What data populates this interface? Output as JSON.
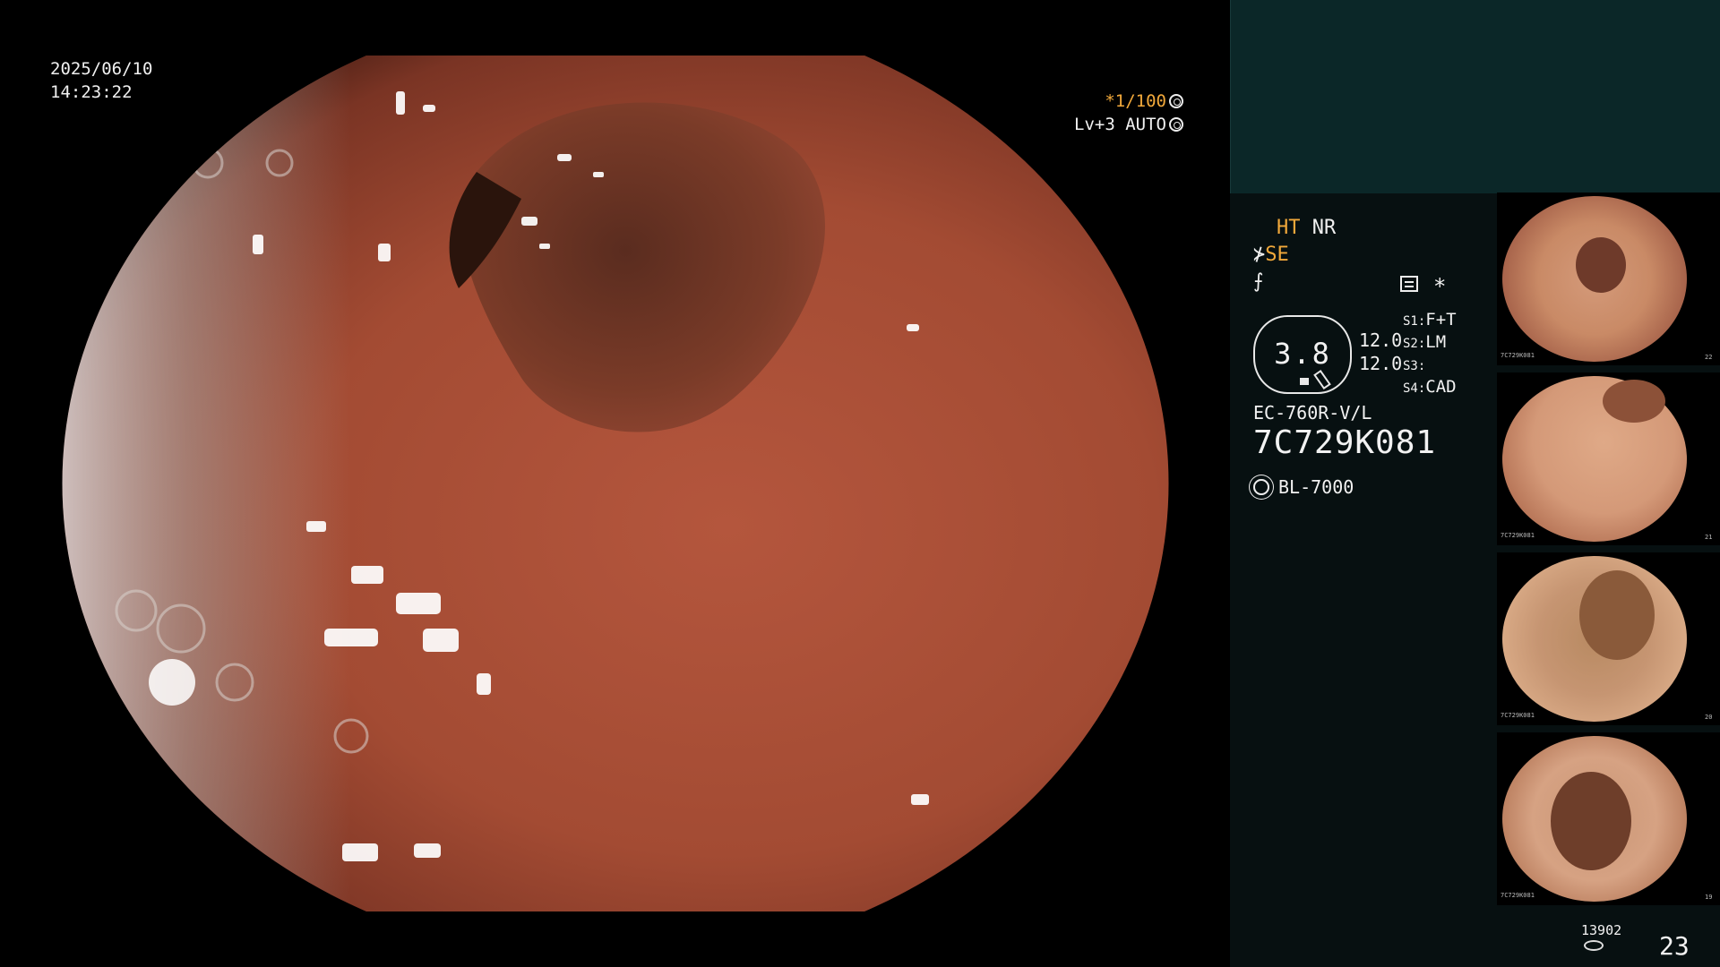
{
  "overlay": {
    "date": "2025/06/10",
    "time": "14:23:22",
    "shutter_prefix": "*1/100",
    "level": "Lv+3 AUTO"
  },
  "panel": {
    "ht": "HT",
    "nr": "NR",
    "se": "SE",
    "mode_symbol_1": "⊁",
    "mode_symbol_2": "⨍",
    "zoom_value": "3.8",
    "num1": "12.0",
    "num2": "12.0",
    "s1_label": "S1:",
    "s1_value": "F+T",
    "s2_label": "S2:",
    "s2_value": "LM",
    "s3_label": "S3:",
    "s3_value": "",
    "s4_label": "S4:",
    "s4_value": "CAD",
    "asterisk": "*",
    "model": "EC-760R-V/L",
    "serial": "7C729K081",
    "light_source": "BL-7000",
    "counter_small": "13902",
    "counter_big": "23"
  },
  "thumbnails": [
    {
      "id": "thumbnail-1",
      "footer": "7C729K081",
      "index": "22"
    },
    {
      "id": "thumbnail-2",
      "footer": "7C729K081",
      "index": "21"
    },
    {
      "id": "thumbnail-3",
      "footer": "7C729K081",
      "index": "20"
    },
    {
      "id": "thumbnail-4",
      "footer": "7C729K081",
      "index": "19"
    }
  ],
  "colors": {
    "accent_orange": "#f2a93b",
    "panel_bg": "#071011",
    "panel_top": "#0b2728"
  }
}
